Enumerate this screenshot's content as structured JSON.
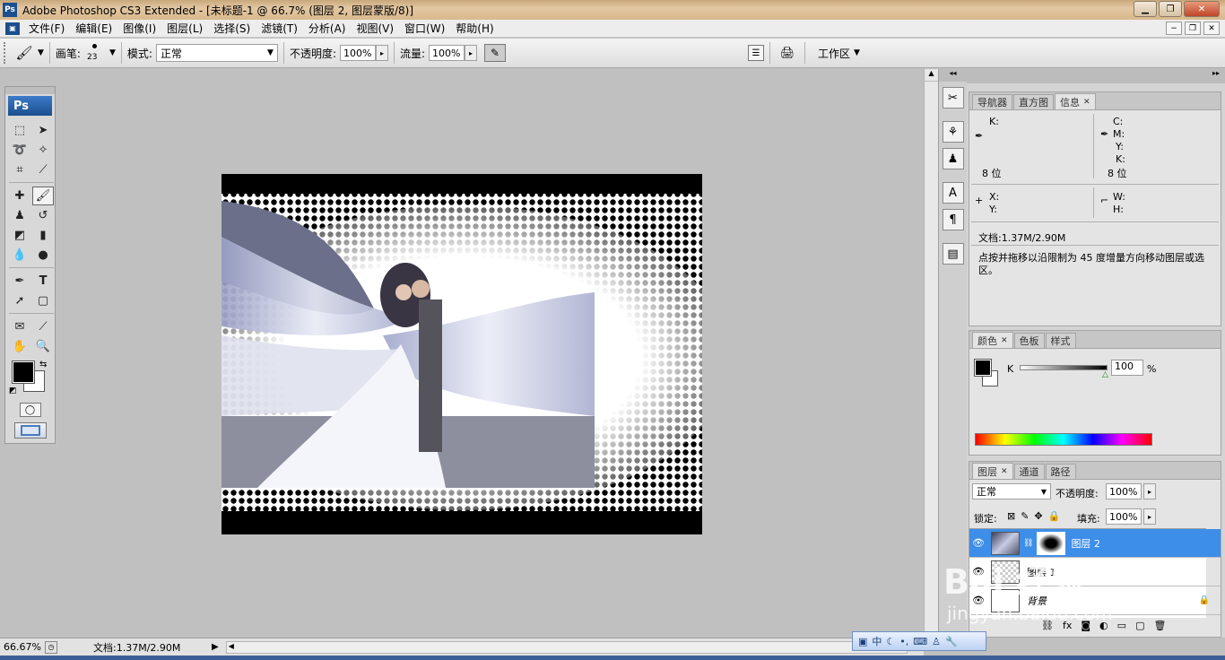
{
  "window": {
    "title": "Adobe Photoshop CS3 Extended - [未标题-1 @ 66.7% (图层 2, 图层蒙版/8)]",
    "app_badge": "Ps",
    "controls": [
      "minimize",
      "maximize",
      "close"
    ]
  },
  "menu": {
    "items": [
      "文件(F)",
      "编辑(E)",
      "图像(I)",
      "图层(L)",
      "选择(S)",
      "滤镜(T)",
      "分析(A)",
      "视图(V)",
      "窗口(W)",
      "帮助(H)"
    ]
  },
  "options": {
    "brush_label": "画笔:",
    "brush_size": "23",
    "mode_label": "模式:",
    "mode_value": "正常",
    "opacity_label": "不透明度:",
    "opacity_value": "100%",
    "flow_label": "流量:",
    "flow_value": "100%",
    "workspace_label": "工作区"
  },
  "toolbox": {
    "logo": "Ps",
    "tools": [
      "marquee-icon",
      "move-icon",
      "lasso-icon",
      "magic-wand-icon",
      "crop-icon",
      "eyedropper-slice-icon",
      "healing-icon",
      "brush-icon",
      "clone-stamp-icon",
      "history-brush-icon",
      "eraser-icon",
      "gradient-icon",
      "blur-icon",
      "dodge-icon",
      "pen-icon",
      "type-icon",
      "path-select-icon",
      "shape-icon",
      "notes-icon",
      "eyedropper-icon",
      "hand-icon",
      "zoom-icon"
    ],
    "foreground_color": "#000000",
    "background_color": "#ffffff"
  },
  "info_panel": {
    "tabs": [
      "导航器",
      "直方图",
      "信息"
    ],
    "active_tab": "信息",
    "left_k": "K:",
    "right_c": "C:",
    "right_m": "M:",
    "right_y": "Y:",
    "right_k": "K:",
    "bits_left": "8 位",
    "bits_right": "8 位",
    "x_label": "X:",
    "y_label": "Y:",
    "w_label": "W:",
    "h_label": "H:",
    "doc_size": "文档:1.37M/2.90M",
    "hint": "点按并拖移以沿限制为 45 度增量方向移动图层或选区。"
  },
  "color_panel": {
    "tabs": [
      "颜色",
      "色板",
      "样式"
    ],
    "channel_label": "K",
    "value": "100",
    "unit": "%"
  },
  "layers_panel": {
    "tabs": [
      "图层",
      "通道",
      "路径"
    ],
    "blend_mode": "正常",
    "opacity_label": "不透明度:",
    "opacity_value": "100%",
    "lock_label": "锁定:",
    "fill_label": "填充:",
    "fill_value": "100%",
    "layers": [
      {
        "name": "图层 2",
        "selected": true
      },
      {
        "name": "图层 1",
        "selected": false
      },
      {
        "name": "背景",
        "selected": false
      }
    ]
  },
  "status": {
    "zoom": "66.67%",
    "doc_size": "文档:1.37M/2.90M"
  },
  "ime": {
    "label": "中"
  },
  "watermark": {
    "main": "Bai 经验",
    "sub": "jingyan.baidu.com"
  }
}
